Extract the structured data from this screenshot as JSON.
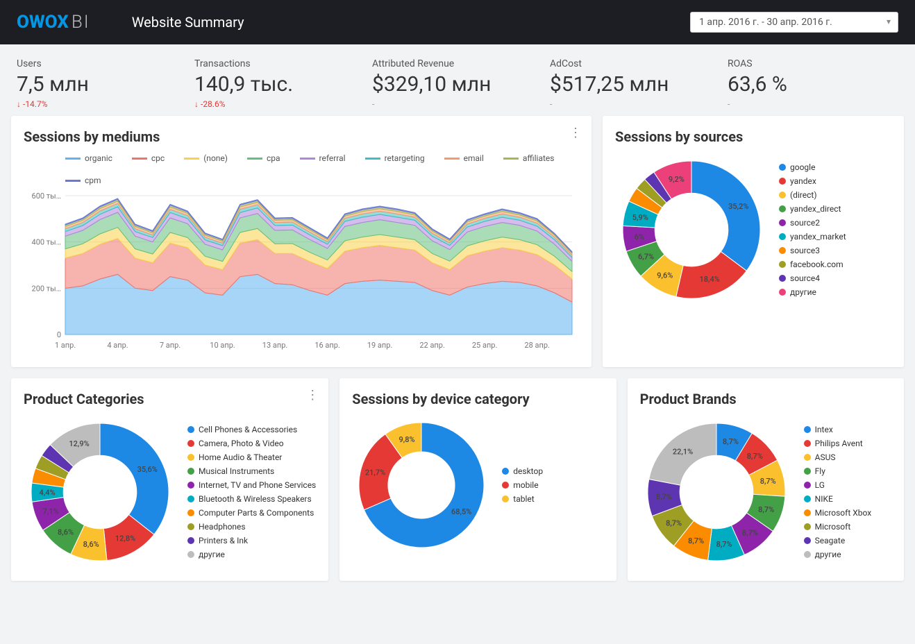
{
  "header": {
    "logo_owox": "OWOX",
    "logo_bi": "BI",
    "title": "Website Summary",
    "date_range": "1 апр. 2016 г. - 30 апр. 2016 г."
  },
  "metrics": [
    {
      "label": "Users",
      "value": "7,5 млн",
      "change": "-14.7%",
      "changeType": "neg"
    },
    {
      "label": "Transactions",
      "value": "140,9 тыс.",
      "change": "-28.6%",
      "changeType": "neg"
    },
    {
      "label": "Attributed Revenue",
      "value": "$329,10 млн",
      "change": "-",
      "changeType": "dash"
    },
    {
      "label": "AdCost",
      "value": "$517,25 млн",
      "change": "-",
      "changeType": "dash"
    },
    {
      "label": "ROAS",
      "value": "63,6 %",
      "change": "-",
      "changeType": "dash"
    }
  ],
  "cards": {
    "sessions_mediums": {
      "title": "Sessions by mediums",
      "legend": [
        "organic",
        "cpc",
        "(none)",
        "cpa",
        "referral",
        "retargeting",
        "email",
        "affiliates",
        "cpm"
      ]
    },
    "sessions_sources": {
      "title": "Sessions by sources"
    },
    "product_categories": {
      "title": "Product Categories"
    },
    "sessions_device": {
      "title": "Sessions by device category"
    },
    "product_brands": {
      "title": "Product Brands"
    }
  },
  "chart_data": [
    {
      "id": "sessions_mediums",
      "type": "area",
      "title": "Sessions by mediums",
      "xlabel": "",
      "ylabel": "",
      "ylim": [
        0,
        600000
      ],
      "yticks": [
        0,
        200000,
        400000,
        600000
      ],
      "ytick_labels": [
        "0",
        "200 ты…",
        "400 ты…",
        "600 ты…"
      ],
      "x": [
        "1 апр.",
        "2 апр.",
        "3 апр.",
        "4 апр.",
        "5 апр.",
        "6 апр.",
        "7 апр.",
        "8 апр.",
        "9 апр.",
        "10 апр.",
        "11 апр.",
        "12 апр.",
        "13 апр.",
        "14 апр.",
        "15 апр.",
        "16 апр.",
        "17 апр.",
        "18 апр.",
        "19 апр.",
        "20 апр.",
        "21 апр.",
        "22 апр.",
        "23 апр.",
        "24 апр.",
        "25 апр.",
        "26 апр.",
        "27 апр.",
        "28 апр.",
        "29 апр.",
        "30 апр."
      ],
      "xtick_labels": [
        "1 апр.",
        "4 апр.",
        "7 апр.",
        "10 апр.",
        "13 апр.",
        "16 апр.",
        "19 апр.",
        "22 апр.",
        "25 апр.",
        "28 апр."
      ],
      "series": [
        {
          "name": "organic",
          "color": "#5eb3f0",
          "values": [
            200,
            210,
            240,
            260,
            200,
            190,
            250,
            235,
            180,
            170,
            250,
            260,
            220,
            215,
            190,
            170,
            220,
            230,
            235,
            230,
            225,
            190,
            170,
            205,
            220,
            230,
            225,
            210,
            180,
            140
          ]
        },
        {
          "name": "cpc",
          "color": "#f0746c",
          "values": [
            130,
            140,
            150,
            155,
            130,
            120,
            145,
            140,
            120,
            110,
            145,
            150,
            130,
            135,
            125,
            115,
            140,
            145,
            150,
            145,
            140,
            120,
            110,
            135,
            140,
            145,
            140,
            135,
            120,
            100
          ]
        },
        {
          "name": "(none)",
          "color": "#f9d14b",
          "values": [
            40,
            42,
            45,
            48,
            40,
            38,
            46,
            44,
            38,
            36,
            46,
            48,
            42,
            43,
            40,
            37,
            45,
            46,
            47,
            46,
            45,
            40,
            37,
            43,
            45,
            46,
            45,
            43,
            38,
            32
          ]
        },
        {
          "name": "cpa",
          "color": "#66c07d",
          "values": [
            55,
            58,
            62,
            65,
            55,
            52,
            63,
            60,
            52,
            50,
            63,
            65,
            58,
            59,
            55,
            50,
            62,
            63,
            64,
            63,
            62,
            55,
            50,
            60,
            62,
            63,
            62,
            59,
            52,
            44
          ]
        },
        {
          "name": "referral",
          "color": "#b085de",
          "values": [
            20,
            21,
            23,
            24,
            20,
            19,
            23,
            22,
            19,
            18,
            23,
            24,
            21,
            21,
            20,
            18,
            22,
            23,
            23,
            23,
            22,
            20,
            18,
            21,
            22,
            23,
            22,
            21,
            19,
            16
          ]
        },
        {
          "name": "retargeting",
          "color": "#3ec0c0",
          "values": [
            12,
            13,
            14,
            14,
            12,
            11,
            14,
            13,
            11,
            11,
            14,
            14,
            13,
            13,
            12,
            11,
            13,
            14,
            14,
            14,
            13,
            12,
            11,
            13,
            13,
            14,
            13,
            13,
            11,
            10
          ]
        },
        {
          "name": "email",
          "color": "#f79a6b",
          "values": [
            10,
            10,
            11,
            11,
            10,
            9,
            11,
            10,
            9,
            9,
            11,
            11,
            10,
            10,
            10,
            9,
            10,
            11,
            11,
            11,
            10,
            10,
            9,
            10,
            10,
            11,
            10,
            10,
            9,
            8
          ]
        },
        {
          "name": "affiliates",
          "color": "#a6b84f",
          "values": [
            6,
            6,
            7,
            7,
            6,
            6,
            7,
            6,
            6,
            5,
            7,
            7,
            6,
            6,
            6,
            5,
            6,
            7,
            7,
            7,
            6,
            6,
            5,
            6,
            6,
            7,
            6,
            6,
            5,
            5
          ]
        },
        {
          "name": "cpm",
          "color": "#6978d8",
          "values": [
            4,
            4,
            4,
            4,
            4,
            4,
            4,
            4,
            4,
            3,
            4,
            4,
            4,
            4,
            4,
            3,
            4,
            4,
            4,
            4,
            4,
            4,
            3,
            4,
            4,
            4,
            4,
            4,
            3,
            3
          ]
        }
      ],
      "series_note": "values are in thousands of sessions (stacked)"
    },
    {
      "id": "sessions_sources",
      "type": "pie",
      "title": "Sessions by sources",
      "slices": [
        {
          "name": "google",
          "value": 35.2,
          "color": "#1e88e5",
          "label": "35,2%"
        },
        {
          "name": "yandex",
          "value": 18.4,
          "color": "#e53935",
          "label": "18,4%"
        },
        {
          "name": "(direct)",
          "value": 9.6,
          "color": "#fbc02d",
          "label": "9,6%"
        },
        {
          "name": "yandex_direct",
          "value": 6.7,
          "color": "#43a047",
          "label": "6,7%"
        },
        {
          "name": "source2",
          "value": 6.0,
          "color": "#8e24aa",
          "label": "6%"
        },
        {
          "name": "yandex_market",
          "value": 5.9,
          "color": "#00acc1",
          "label": "5,9%"
        },
        {
          "name": "source3",
          "value": 3.5,
          "color": "#fb8c00",
          "label": ""
        },
        {
          "name": "facebook.com",
          "value": 2.8,
          "color": "#9e9d24",
          "label": ""
        },
        {
          "name": "source4",
          "value": 2.7,
          "color": "#5e35b1",
          "label": ""
        },
        {
          "name": "другие",
          "value": 9.2,
          "color": "#ec407a",
          "label": "9,2%"
        }
      ]
    },
    {
      "id": "product_categories",
      "type": "pie",
      "title": "Product Categories",
      "slices": [
        {
          "name": "Cell Phones & Accessories",
          "value": 35.6,
          "color": "#1e88e5",
          "label": "35,6%"
        },
        {
          "name": "Camera, Photo & Video",
          "value": 12.8,
          "color": "#e53935",
          "label": "12,8%"
        },
        {
          "name": "Home Audio & Theater",
          "value": 8.6,
          "color": "#fbc02d",
          "label": "8,6%"
        },
        {
          "name": "Musical Instruments",
          "value": 8.6,
          "color": "#43a047",
          "label": "8,6%"
        },
        {
          "name": "Internet, TV and Phone Services",
          "value": 7.1,
          "color": "#8e24aa",
          "label": "7,1%"
        },
        {
          "name": "Bluetooth & Wireless Speakers",
          "value": 4.4,
          "color": "#00acc1",
          "label": "4,4%"
        },
        {
          "name": "Computer Parts & Components",
          "value": 3.5,
          "color": "#fb8c00",
          "label": ""
        },
        {
          "name": "Headphones",
          "value": 3.3,
          "color": "#9e9d24",
          "label": ""
        },
        {
          "name": "Printers & Ink",
          "value": 3.2,
          "color": "#5e35b1",
          "label": ""
        },
        {
          "name": "другие",
          "value": 12.9,
          "color": "#bdbdbd",
          "label": "12,9%"
        }
      ]
    },
    {
      "id": "sessions_device",
      "type": "pie",
      "title": "Sessions by device category",
      "slices": [
        {
          "name": "desktop",
          "value": 68.5,
          "color": "#1e88e5",
          "label": "68,5%"
        },
        {
          "name": "mobile",
          "value": 21.7,
          "color": "#e53935",
          "label": "21,7%"
        },
        {
          "name": "tablet",
          "value": 9.8,
          "color": "#fbc02d",
          "label": "9,8%"
        }
      ]
    },
    {
      "id": "product_brands",
      "type": "pie",
      "title": "Product Brands",
      "slices": [
        {
          "name": "Intex",
          "value": 8.7,
          "color": "#1e88e5",
          "label": "8,7%"
        },
        {
          "name": "Philips Avent",
          "value": 8.7,
          "color": "#e53935",
          "label": "8,7%"
        },
        {
          "name": "ASUS",
          "value": 8.7,
          "color": "#fbc02d",
          "label": "8,7%"
        },
        {
          "name": "Fly",
          "value": 8.7,
          "color": "#43a047",
          "label": "8,7%"
        },
        {
          "name": "LG",
          "value": 8.7,
          "color": "#8e24aa",
          "label": "8,7%"
        },
        {
          "name": "NIKE",
          "value": 8.7,
          "color": "#00acc1",
          "label": "8,7%"
        },
        {
          "name": "Microsoft Xbox",
          "value": 8.7,
          "color": "#fb8c00",
          "label": "8,7%"
        },
        {
          "name": "Microsoft",
          "value": 8.7,
          "color": "#9e9d24",
          "label": "8,7%"
        },
        {
          "name": "Seagate",
          "value": 8.7,
          "color": "#5e35b1",
          "label": "8,7%"
        },
        {
          "name": "другие",
          "value": 22.1,
          "color": "#bdbdbd",
          "label": "22,1%"
        }
      ]
    }
  ]
}
